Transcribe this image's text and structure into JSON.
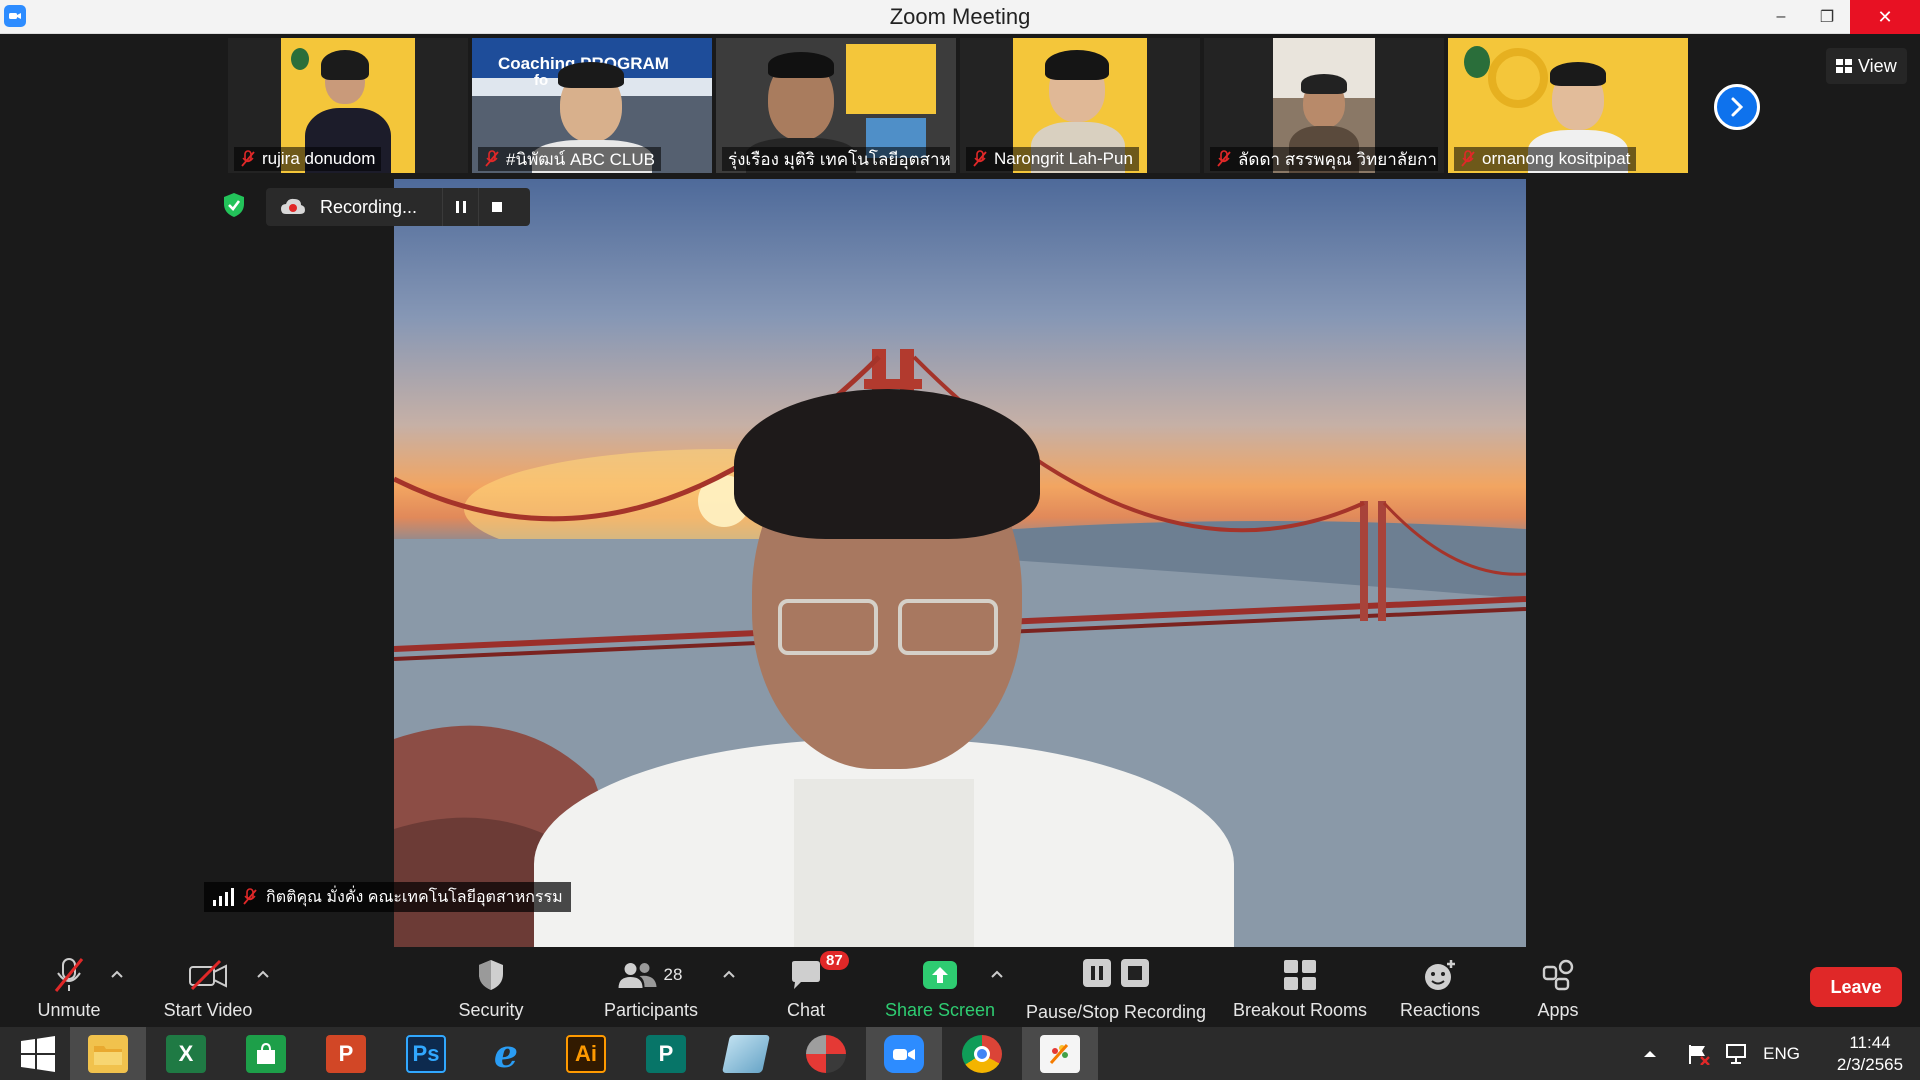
{
  "window": {
    "title": "Zoom Meeting",
    "minimize": "–",
    "restore": "❐",
    "close": "✕"
  },
  "view_button": {
    "label": "View"
  },
  "participants_strip": [
    {
      "name": "rujira donudom",
      "bg": "#f4c63a"
    },
    {
      "name": "#นิพัฒน์ ABC CLUB",
      "bg": "#2f5ea8",
      "banner": "Coaching PROGRAM",
      "banner2": "fo        er"
    },
    {
      "name": "รุ่งเรือง มุติริ เทคโนโลยีอุตสาหกร...",
      "bg": "#3c3c3c"
    },
    {
      "name": "Narongrit Lah-Pun",
      "bg": "#f4c63a"
    },
    {
      "name": "ลัดดา สรรพคุณ วิทยาลัยกา...",
      "bg": "#6e5a4a"
    },
    {
      "name": "ornanong kositpipat",
      "bg": "#f4c63a"
    }
  ],
  "recording": {
    "label": "Recording..."
  },
  "active_speaker": {
    "name": "กิตติคุณ มั่งคั่ง คณะเทคโนโลยีอุตสาหกรรม"
  },
  "toolbar": {
    "unmute": "Unmute",
    "start_video": "Start Video",
    "security": "Security",
    "participants": "Participants",
    "participants_count": "28",
    "chat": "Chat",
    "chat_badge": "87",
    "share_screen": "Share Screen",
    "pause_stop_recording": "Pause/Stop Recording",
    "breakout_rooms": "Breakout Rooms",
    "reactions": "Reactions",
    "apps": "Apps",
    "leave": "Leave"
  },
  "taskbar": {
    "apps": [
      {
        "id": "file-explorer",
        "label": ""
      },
      {
        "id": "excel",
        "label": "X"
      },
      {
        "id": "store",
        "label": ""
      },
      {
        "id": "powerpoint",
        "label": "P"
      },
      {
        "id": "photoshop",
        "label": "Ps"
      },
      {
        "id": "internet-explorer",
        "label": "e"
      },
      {
        "id": "illustrator",
        "label": "Ai"
      },
      {
        "id": "publisher",
        "label": "P"
      },
      {
        "id": "notes",
        "label": ""
      },
      {
        "id": "photoscape",
        "label": ""
      },
      {
        "id": "zoom",
        "label": ""
      },
      {
        "id": "chrome",
        "label": ""
      },
      {
        "id": "paint",
        "label": ""
      }
    ],
    "language": "ENG",
    "time": "11:44",
    "date": "2/3/2565"
  },
  "colors": {
    "accent": "#0e72ed",
    "leave": "#e02828",
    "share_green": "#2ecc71",
    "rec_red": "#e02828"
  }
}
